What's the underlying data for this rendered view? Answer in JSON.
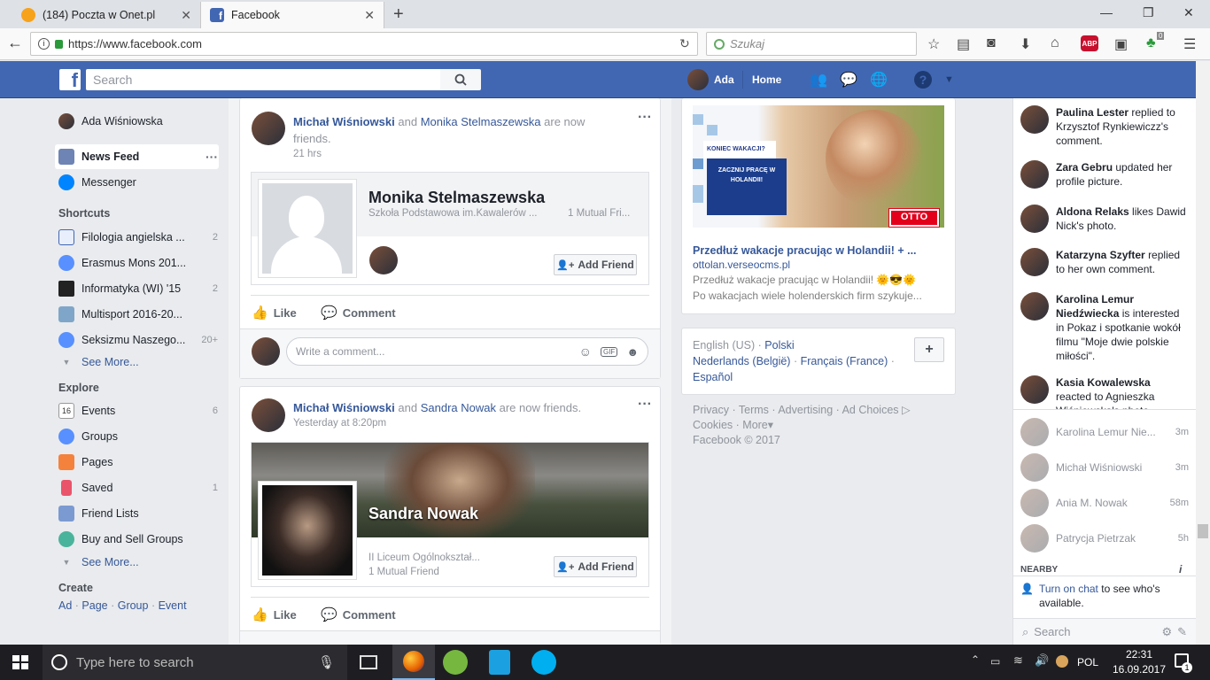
{
  "browser": {
    "tabs": [
      {
        "title": "(184) Poczta w Onet.pl"
      },
      {
        "title": "Facebook"
      }
    ],
    "url": "https://www.facebook.com",
    "search_placeholder": "Szukaj",
    "adblock_label": "ABP",
    "ext_badge": "0"
  },
  "fb_header": {
    "logo": "f",
    "search_placeholder": "Search",
    "user_name": "Ada",
    "home_label": "Home"
  },
  "left_nav": {
    "profile_name": "Ada Wiśniowska",
    "items": [
      {
        "label": "News Feed",
        "more": "···"
      },
      {
        "label": "Messenger"
      }
    ],
    "shortcuts_title": "Shortcuts",
    "shortcuts": [
      {
        "label": "Filologia angielska ...",
        "count": "2"
      },
      {
        "label": "Erasmus Mons 201...",
        "count": ""
      },
      {
        "label": "Informatyka (WI) '15",
        "count": "2"
      },
      {
        "label": "Multisport 2016-20...",
        "count": ""
      },
      {
        "label": "Seksizmu Naszego...",
        "count": "20+"
      }
    ],
    "see_more_1": "See More...",
    "explore_title": "Explore",
    "explore": [
      {
        "label": "Events",
        "count": "6"
      },
      {
        "label": "Groups",
        "count": ""
      },
      {
        "label": "Pages",
        "count": ""
      },
      {
        "label": "Saved",
        "count": "1"
      },
      {
        "label": "Friend Lists",
        "count": ""
      },
      {
        "label": "Buy and Sell Groups",
        "count": ""
      }
    ],
    "see_more_2": "See More...",
    "create_title": "Create",
    "create_links": [
      "Ad",
      "Page",
      "Group",
      "Event"
    ],
    "events_icon_number": "16"
  },
  "feed": {
    "post1": {
      "actor": "Michał Wiśniowski",
      "connector": "and",
      "friend": "Monika Stelmaszewska",
      "tail": "are now friends.",
      "time": "21 hrs",
      "card_name": "Monika Stelmaszewska",
      "card_school": "Szkoła Podstawowa im.Kawalerów ...",
      "card_mutual": "1 Mutual Fri...",
      "add_friend": "Add Friend",
      "like": "Like",
      "comment": "Comment",
      "comment_placeholder": "Write a comment...",
      "gif_label": "GIF"
    },
    "post2": {
      "actor": "Michał Wiśniowski",
      "connector": "and",
      "friend": "Sandra Nowak",
      "tail": "are now friends.",
      "time": "Yesterday at 8:20pm",
      "card_name": "Sandra Nowak",
      "card_school": "II Liceum Ogólnokształ...",
      "card_mutual": "1 Mutual Friend",
      "add_friend": "Add Friend",
      "like": "Like",
      "comment": "Comment"
    }
  },
  "ad": {
    "banner_line1": "KONIEC WAKACJI?",
    "banner_line2": "ZACZNIJ PRACĘ W HOLANDII!",
    "brand": "OTTO",
    "brand_sub": "workforce.eu",
    "title": "Przedłuż wakacje pracując w Holandii! + ...",
    "domain": "ottolan.verseocms.pl",
    "desc1": "Przedłuż wakacje pracując w Holandii! 🌞😎🌞",
    "desc2": "Po wakacjach wiele holenderskich firm szykuje..."
  },
  "languages": {
    "items": [
      "English (US)",
      "Polski",
      "Nederlands (België)",
      "Français (France)",
      "Español"
    ],
    "add": "+"
  },
  "footer_links": {
    "privacy": "Privacy",
    "terms": "Terms",
    "advertising": "Advertising",
    "ad_choices": "Ad Choices",
    "cookies": "Cookies",
    "more": "More",
    "copyright": "Facebook © 2017"
  },
  "ticker": [
    {
      "name": "Paulina Lester",
      "text": "replied to Krzysztof Rynkiewiczz's comment."
    },
    {
      "name": "Zara Gebru",
      "text": "updated her profile picture."
    },
    {
      "name": "Aldona Relaks",
      "text": "likes Dawid Nick's photo."
    },
    {
      "name": "Katarzyna Szyfter",
      "text": "replied to her own comment."
    },
    {
      "name": "Karolina Lemur Niedźwiecka",
      "text": "is interested in Pokaz i spotkanie wokół filmu \"Moje dwie polskie miłości\"."
    },
    {
      "name": "Kasia Kowalewska",
      "text": "reacted to Agnieszka Wiśniowska's photo."
    }
  ],
  "contacts": [
    {
      "name": "Karolina Lemur Nie...",
      "time": "3m"
    },
    {
      "name": "Michał Wiśniowski",
      "time": "3m"
    },
    {
      "name": "Ania M. Nowak",
      "time": "58m"
    },
    {
      "name": "Patrycja Pietrzak",
      "time": "5h"
    }
  ],
  "chat": {
    "nearby": "NEARBY",
    "turn_on_link": "Turn on chat",
    "turn_on_text": "to see who's available.",
    "search_placeholder": "Search"
  },
  "taskbar": {
    "search_placeholder": "Type here to search",
    "lang": "POL",
    "time": "22:31",
    "date": "16.09.2017",
    "notif_count": "1"
  },
  "colors": {
    "fb_blue": "#4267b2",
    "link": "#365899",
    "bg": "#e9ebee"
  }
}
